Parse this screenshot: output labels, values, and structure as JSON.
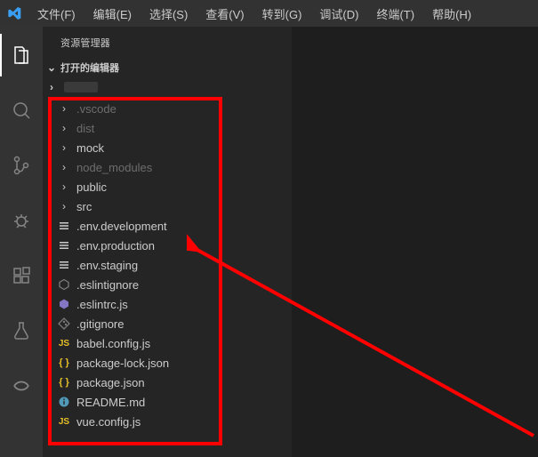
{
  "menu": {
    "file": "文件(F)",
    "edit": "编辑(E)",
    "select": "选择(S)",
    "view": "查看(V)",
    "go": "转到(G)",
    "debug": "调试(D)",
    "terminal": "终端(T)",
    "help": "帮助(H)"
  },
  "sidebar": {
    "title": "资源管理器",
    "open_editors": "打开的编辑器"
  },
  "tree": [
    {
      "name": ".vscode",
      "type": "folder",
      "dim": true
    },
    {
      "name": "dist",
      "type": "folder",
      "dim": true
    },
    {
      "name": "mock",
      "type": "folder",
      "dim": false
    },
    {
      "name": "node_modules",
      "type": "folder",
      "dim": true
    },
    {
      "name": "public",
      "type": "folder",
      "dim": false
    },
    {
      "name": "src",
      "type": "folder",
      "dim": false
    },
    {
      "name": ".env.development",
      "type": "env",
      "dim": false
    },
    {
      "name": ".env.production",
      "type": "env",
      "dim": false
    },
    {
      "name": ".env.staging",
      "type": "env",
      "dim": false
    },
    {
      "name": ".eslintignore",
      "type": "eslintignore",
      "dim": false
    },
    {
      "name": ".eslintrc.js",
      "type": "eslint",
      "dim": false
    },
    {
      "name": ".gitignore",
      "type": "git",
      "dim": false
    },
    {
      "name": "babel.config.js",
      "type": "js",
      "dim": false
    },
    {
      "name": "package-lock.json",
      "type": "json",
      "dim": false
    },
    {
      "name": "package.json",
      "type": "json",
      "dim": false
    },
    {
      "name": "README.md",
      "type": "info",
      "dim": false
    },
    {
      "name": "vue.config.js",
      "type": "js",
      "dim": false
    }
  ],
  "colors": {
    "js": "#e6c029",
    "json": "#e6c029",
    "eslint": "#8476c2",
    "info": "#519aba",
    "git": "#7a7a7a",
    "env": "#cccccc",
    "ignore": "#7a7a7a"
  }
}
